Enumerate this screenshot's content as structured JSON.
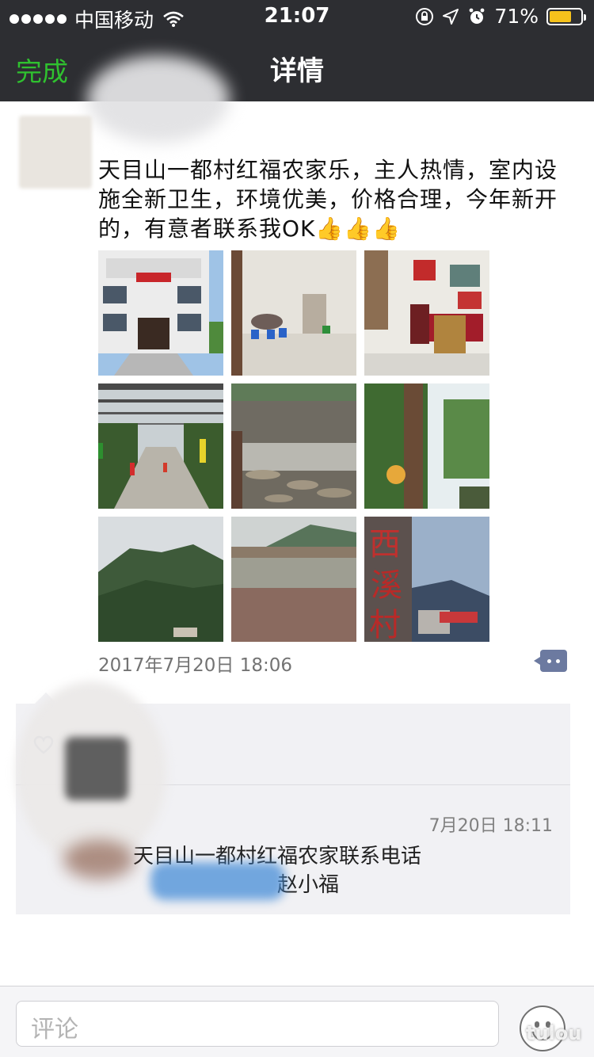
{
  "status_bar": {
    "carrier": "中国移动",
    "time": "21:07",
    "battery_percent": "71%",
    "battery_level": 0.71,
    "battery_color": "#f6c21c"
  },
  "nav": {
    "done_label": "完成",
    "title": "详情"
  },
  "post": {
    "text": "天目山一都村红福农家乐，主人热情，室内设施全新卫生，环境优美，价格合理，今年新开的，有意者联系我OK",
    "thumbs": "👍👍👍",
    "timestamp": "2017年7月20日 18:06",
    "photos": [
      {
        "name": "photo-farmhouse-exterior",
        "icon": "building-photo"
      },
      {
        "name": "photo-dining-hall",
        "icon": "interior-photo"
      },
      {
        "name": "photo-living-room",
        "icon": "interior-photo"
      },
      {
        "name": "photo-covered-walkway",
        "icon": "walkway-photo"
      },
      {
        "name": "photo-stream-stones",
        "icon": "stream-photo"
      },
      {
        "name": "photo-fruit-tree",
        "icon": "tree-photo"
      },
      {
        "name": "photo-mountains",
        "icon": "mountain-photo"
      },
      {
        "name": "photo-lake-bridge",
        "icon": "lake-photo"
      },
      {
        "name": "photo-village-sign",
        "icon": "stone-sign-photo"
      }
    ]
  },
  "comments": {
    "time": "7月20日 18:11",
    "line1": "天目山一都村红福农家联系电话",
    "line2": "赵小福"
  },
  "input": {
    "placeholder": "评论"
  },
  "colors": {
    "header_bg": "#2d2e32",
    "accent_green": "#2fc12f",
    "link_blue": "#6c7aa0"
  },
  "watermark": "tulou"
}
